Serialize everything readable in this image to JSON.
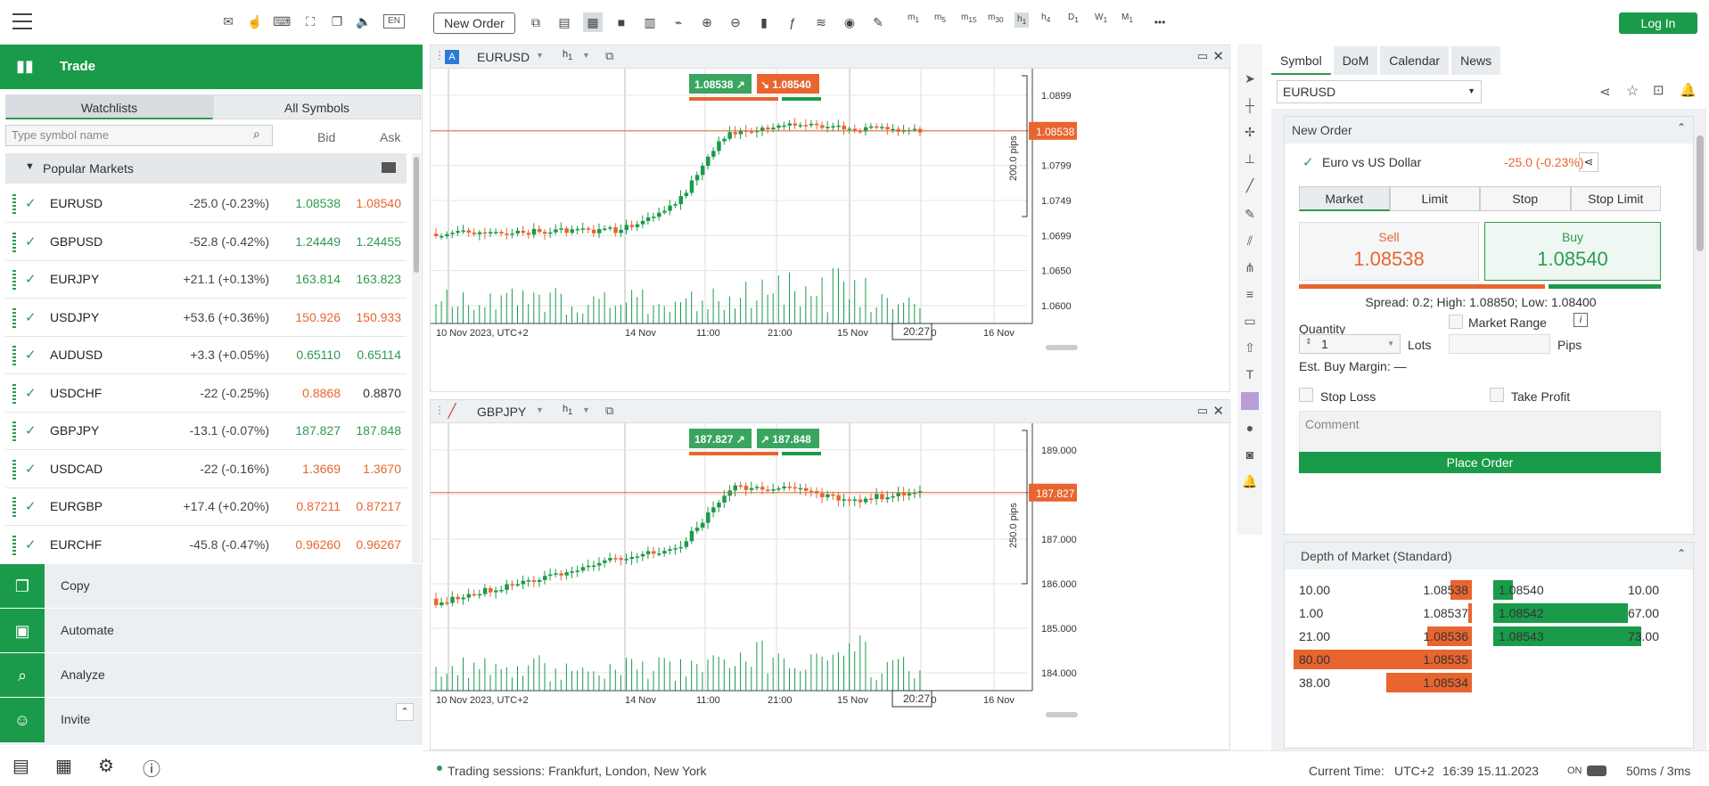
{
  "toolbar": {
    "new_order": "New Order",
    "login": "Log In",
    "timeframes": [
      {
        "l": "m",
        "s": "1"
      },
      {
        "l": "m",
        "s": "5"
      },
      {
        "l": "m",
        "s": "15"
      },
      {
        "l": "m",
        "s": "30"
      },
      {
        "l": "h",
        "s": "1"
      },
      {
        "l": "h",
        "s": "4"
      },
      {
        "l": "D",
        "s": "1"
      },
      {
        "l": "W",
        "s": "1"
      },
      {
        "l": "M",
        "s": "1"
      }
    ],
    "more": "•••"
  },
  "left_top": {
    "lang": "EN"
  },
  "trade": {
    "title": "Trade"
  },
  "watch": {
    "tabs": [
      "Watchlists",
      "All Symbols"
    ],
    "search_placeholder": "Type symbol name",
    "bid": "Bid",
    "ask": "Ask",
    "group": "Popular Markets",
    "rows": [
      {
        "sym": "EURUSD",
        "chg": "-25.0 (-0.23%)",
        "bid": "1.08538",
        "ask": "1.08540",
        "bc": "green",
        "ac": "orange"
      },
      {
        "sym": "GBPUSD",
        "chg": "-52.8 (-0.42%)",
        "bid": "1.24449",
        "ask": "1.24455",
        "bc": "green",
        "ac": "green"
      },
      {
        "sym": "EURJPY",
        "chg": "+21.1 (+0.13%)",
        "bid": "163.814",
        "ask": "163.823",
        "bc": "green",
        "ac": "green"
      },
      {
        "sym": "USDJPY",
        "chg": "+53.6 (+0.36%)",
        "bid": "150.926",
        "ask": "150.933",
        "bc": "orange",
        "ac": "orange"
      },
      {
        "sym": "AUDUSD",
        "chg": "+3.3 (+0.05%)",
        "bid": "0.65110",
        "ask": "0.65114",
        "bc": "green",
        "ac": "green"
      },
      {
        "sym": "USDCHF",
        "chg": "-22 (-0.25%)",
        "bid": "0.8868",
        "ask": "0.8870",
        "bc": "orange",
        "ac": "dark"
      },
      {
        "sym": "GBPJPY",
        "chg": "-13.1 (-0.07%)",
        "bid": "187.827",
        "ask": "187.848",
        "bc": "green",
        "ac": "green"
      },
      {
        "sym": "USDCAD",
        "chg": "-22 (-0.16%)",
        "bid": "1.3669",
        "ask": "1.3670",
        "bc": "orange",
        "ac": "orange"
      },
      {
        "sym": "EURGBP",
        "chg": "+17.4 (+0.20%)",
        "bid": "0.87211",
        "ask": "0.87217",
        "bc": "orange",
        "ac": "orange"
      },
      {
        "sym": "EURCHF",
        "chg": "-45.8 (-0.47%)",
        "bid": "0.96260",
        "ask": "0.96267",
        "bc": "orange",
        "ac": "orange"
      }
    ]
  },
  "menu": [
    "Copy",
    "Automate",
    "Analyze",
    "Invite"
  ],
  "chart1": {
    "symbol": "EURUSD",
    "flag": "A",
    "tf": "h",
    "tfs": "1",
    "sell": "1.08538",
    "buy": "1.08540",
    "last": "1.08538",
    "pips": "200.0 pips",
    "crosstime": "20:27",
    "yticks": [
      "1.0899",
      "1.0849",
      "1.0799",
      "1.0749",
      "1.0699",
      "1.0650",
      "1.0600"
    ],
    "xticks": [
      "10 Nov 2023, UTC+2",
      "14 Nov",
      "11:00",
      "21:00",
      "15 Nov",
      "17:00",
      "16 Nov"
    ]
  },
  "chart2": {
    "symbol": "GBPJPY",
    "tf": "h",
    "tfs": "1",
    "sell": "187.827",
    "buy": "187.848",
    "last": "187.827",
    "pips": "250.0 pips",
    "crosstime": "20:27",
    "yticks": [
      "189.000",
      "188.000",
      "187.000",
      "186.000",
      "185.000",
      "184.000"
    ],
    "xticks": [
      "10 Nov 2023, UTC+2",
      "14 Nov",
      "11:00",
      "21:00",
      "15 Nov",
      "17:00",
      "16 Nov"
    ]
  },
  "rpanel": {
    "tabs": [
      "Symbol",
      "DoM",
      "Calendar",
      "News"
    ],
    "symbol": "EURUSD",
    "new_order": "New Order",
    "instrument": "Euro vs US Dollar",
    "change": "-25.0 (-0.23%)",
    "order_tabs": [
      "Market",
      "Limit",
      "Stop",
      "Stop Limit"
    ],
    "sell_label": "Sell",
    "sell_price": "1.08538",
    "buy_label": "Buy",
    "buy_price": "1.08540",
    "spread": "Spread: 0.2; High: 1.08850; Low: 1.08400",
    "quantity": "Quantity",
    "market_range": "Market Range",
    "qty_value": "1",
    "lots": "Lots",
    "pips": "Pips",
    "margin": "Est. Buy Margin: —",
    "stop_loss": "Stop Loss",
    "take_profit": "Take Profit",
    "comment": "Comment",
    "place_order": "Place Order",
    "dom_title": "Depth of Market (Standard)",
    "dom_bids": [
      {
        "v": "10.00",
        "p": "1.08538",
        "w": 0.12
      },
      {
        "v": "1.00",
        "p": "1.08537",
        "w": 0.02
      },
      {
        "v": "21.00",
        "p": "1.08536",
        "w": 0.25
      },
      {
        "v": "80.00",
        "p": "1.08535",
        "w": 1.0
      },
      {
        "v": "38.00",
        "p": "1.08534",
        "w": 0.48
      }
    ],
    "dom_asks": [
      {
        "p": "1.08540",
        "v": "10.00",
        "w": 0.12
      },
      {
        "p": "1.08542",
        "v": "67.00",
        "w": 0.84
      },
      {
        "p": "1.08543",
        "v": "73.00",
        "w": 0.92
      }
    ]
  },
  "status": {
    "sessions": "Trading sessions: Frankfurt, London, New York",
    "current_time": "Current Time:",
    "tz": "UTC+2",
    "datetime": "16:39 15.11.2023",
    "on": "ON",
    "latency": "50ms / 3ms"
  }
}
